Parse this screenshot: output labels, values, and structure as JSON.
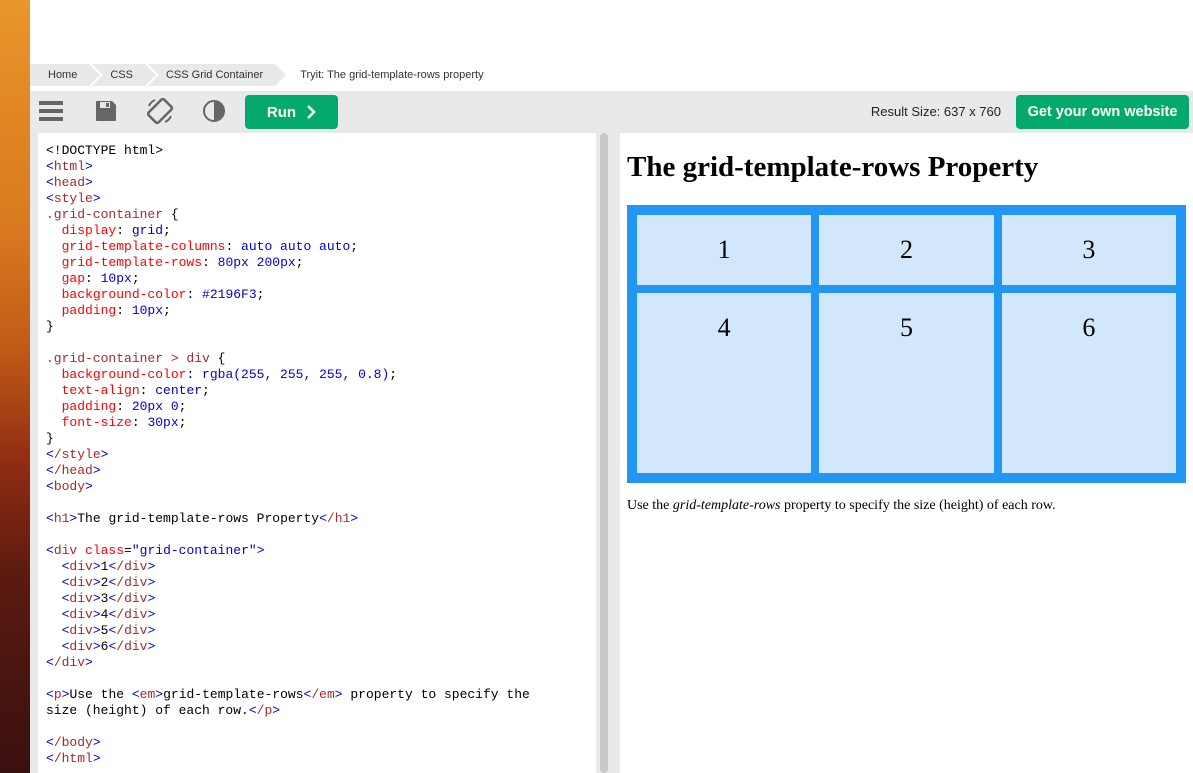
{
  "breadcrumb": [
    "Home",
    "CSS",
    "CSS Grid Container",
    "Tryit: The grid-template-rows property"
  ],
  "toolbar": {
    "icons": [
      "menu-icon",
      "save-icon",
      "rotate-icon",
      "contrast-icon"
    ],
    "run_label": "Run",
    "result_size": "Result Size: 637 x 760",
    "get_website_label": "Get your own website"
  },
  "result": {
    "heading": "The grid-template-rows Property",
    "cells": [
      "1",
      "2",
      "3",
      "4",
      "5",
      "6"
    ],
    "desc_before": "Use the ",
    "desc_em": "grid-template-rows",
    "desc_after": " property to specify the size (height) of each row."
  },
  "colors": {
    "accent": "#04aa6d",
    "grid_bg": "#2196F3",
    "toolbar": "#e7e9eb"
  }
}
